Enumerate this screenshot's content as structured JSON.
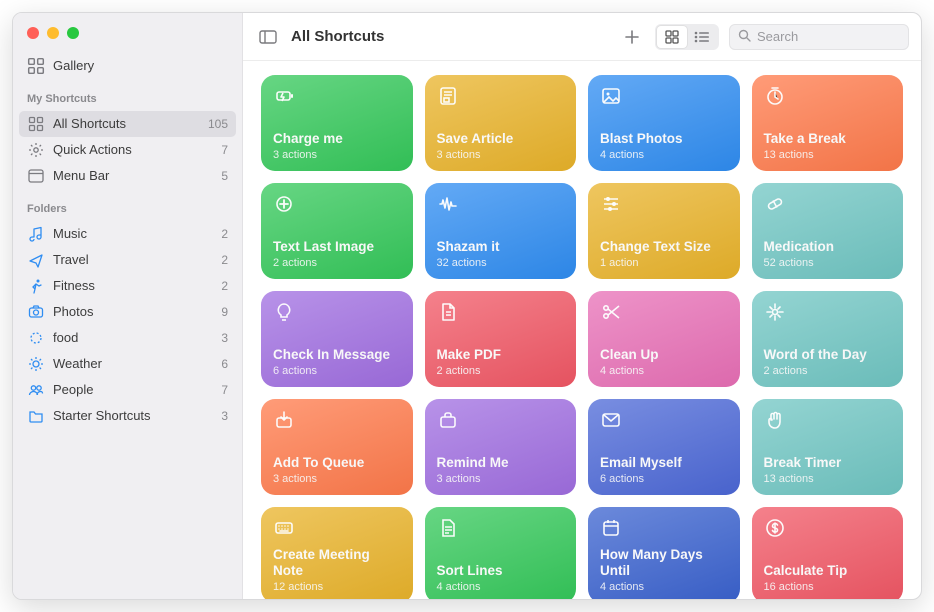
{
  "sidebar": {
    "gallery_label": "Gallery",
    "section_my": "My Shortcuts",
    "section_folders": "Folders",
    "my": [
      {
        "label": "All Shortcuts",
        "count": "105",
        "icon": "grid",
        "selected": true
      },
      {
        "label": "Quick Actions",
        "count": "7",
        "icon": "gear"
      },
      {
        "label": "Menu Bar",
        "count": "5",
        "icon": "menubar"
      }
    ],
    "folders": [
      {
        "label": "Music",
        "count": "2",
        "icon": "music",
        "color": "#2f8df2"
      },
      {
        "label": "Travel",
        "count": "2",
        "icon": "plane",
        "color": "#2f8df2"
      },
      {
        "label": "Fitness",
        "count": "2",
        "icon": "run",
        "color": "#2f8df2"
      },
      {
        "label": "Photos",
        "count": "9",
        "icon": "camera",
        "color": "#2f8df2"
      },
      {
        "label": "food",
        "count": "3",
        "icon": "ring",
        "color": "#2f8df2"
      },
      {
        "label": "Weather",
        "count": "6",
        "icon": "sun",
        "color": "#2f8df2"
      },
      {
        "label": "People",
        "count": "7",
        "icon": "people",
        "color": "#2f8df2"
      },
      {
        "label": "Starter Shortcuts",
        "count": "3",
        "icon": "folder",
        "color": "#2f8df2"
      }
    ]
  },
  "toolbar": {
    "title": "All Shortcuts",
    "search_placeholder": "Search"
  },
  "shortcuts": [
    {
      "title": "Charge me",
      "sub": "3 actions",
      "color": "c-green",
      "icon": "battery"
    },
    {
      "title": "Save Article",
      "sub": "3 actions",
      "color": "c-yellow",
      "icon": "article"
    },
    {
      "title": "Blast Photos",
      "sub": "4 actions",
      "color": "c-blue",
      "icon": "image"
    },
    {
      "title": "Take a Break",
      "sub": "13 actions",
      "color": "c-orange",
      "icon": "timer"
    },
    {
      "title": "Text Last Image",
      "sub": "2 actions",
      "color": "c-green",
      "icon": "sendplus"
    },
    {
      "title": "Shazam it",
      "sub": "32 actions",
      "color": "c-blue",
      "icon": "wave"
    },
    {
      "title": "Change Text Size",
      "sub": "1 action",
      "color": "c-yellow",
      "icon": "sliders"
    },
    {
      "title": "Medication",
      "sub": "52 actions",
      "color": "c-teal",
      "icon": "pill"
    },
    {
      "title": "Check In Message",
      "sub": "6 actions",
      "color": "c-purple",
      "icon": "bulb"
    },
    {
      "title": "Make PDF",
      "sub": "2 actions",
      "color": "c-red",
      "icon": "doc"
    },
    {
      "title": "Clean Up",
      "sub": "4 actions",
      "color": "c-pink",
      "icon": "scissors"
    },
    {
      "title": "Word of the Day",
      "sub": "2 actions",
      "color": "c-teal",
      "icon": "sparkle"
    },
    {
      "title": "Add To Queue",
      "sub": "3 actions",
      "color": "c-orange",
      "icon": "tray"
    },
    {
      "title": "Remind Me",
      "sub": "3 actions",
      "color": "c-purple",
      "icon": "briefcase"
    },
    {
      "title": "Email Myself",
      "sub": "6 actions",
      "color": "c-dblue",
      "icon": "mail"
    },
    {
      "title": "Break Timer",
      "sub": "13 actions",
      "color": "c-teal",
      "icon": "hand"
    },
    {
      "title": "Create Meeting Note",
      "sub": "12 actions",
      "color": "c-yellow",
      "icon": "keyboard"
    },
    {
      "title": "Sort Lines",
      "sub": "4 actions",
      "color": "c-green",
      "icon": "doclines"
    },
    {
      "title": "How Many Days Until",
      "sub": "4 actions",
      "color": "c-navy",
      "icon": "calendar"
    },
    {
      "title": "Calculate Tip",
      "sub": "16 actions",
      "color": "c-red",
      "icon": "dollar"
    }
  ]
}
